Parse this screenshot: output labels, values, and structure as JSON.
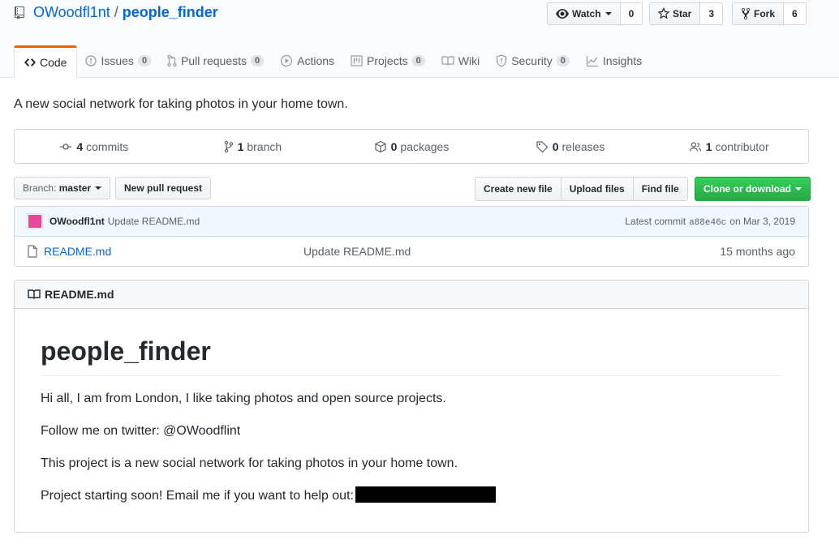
{
  "repo": {
    "owner": "OWoodfl1nt",
    "separator": "/",
    "name": "people_finder"
  },
  "actions": {
    "watch": {
      "label": "Watch",
      "count": "0"
    },
    "star": {
      "label": "Star",
      "count": "3"
    },
    "fork": {
      "label": "Fork",
      "count": "6"
    }
  },
  "tabs": [
    {
      "label": "Code",
      "icon": "code-icon",
      "selected": true
    },
    {
      "label": "Issues",
      "icon": "issue-icon",
      "badge": "0"
    },
    {
      "label": "Pull requests",
      "icon": "pull-request-icon",
      "badge": "0"
    },
    {
      "label": "Actions",
      "icon": "play-icon"
    },
    {
      "label": "Projects",
      "icon": "project-icon",
      "badge": "0"
    },
    {
      "label": "Wiki",
      "icon": "book-icon"
    },
    {
      "label": "Security",
      "icon": "shield-icon",
      "badge": "0"
    },
    {
      "label": "Insights",
      "icon": "graph-icon"
    }
  ],
  "description": "A new social network for taking photos in your home town.",
  "summary": {
    "commits": {
      "count": "4",
      "label": "commits"
    },
    "branches": {
      "count": "1",
      "label": "branch"
    },
    "packages": {
      "count": "0",
      "label": "packages"
    },
    "releases": {
      "count": "0",
      "label": "releases"
    },
    "contributors": {
      "count": "1",
      "label": "contributor"
    }
  },
  "toolbar": {
    "branch_prefix": "Branch:",
    "branch_name": "master",
    "new_pr": "New pull request",
    "create_file": "Create new file",
    "upload_files": "Upload files",
    "find_file": "Find file",
    "clone": "Clone or download"
  },
  "latest_commit": {
    "author": "OWoodfl1nt",
    "message": "Update README.md",
    "prefix": "Latest commit",
    "sha": "a88e46c",
    "date": "on Mar 3, 2019"
  },
  "files": [
    {
      "name": "README.md",
      "message": "Update README.md",
      "age": "15 months ago"
    }
  ],
  "readme": {
    "filename": "README.md",
    "title": "people_finder",
    "paragraphs": [
      "Hi all, I am from London, I like taking photos and open source projects.",
      "Follow me on twitter: @OWoodflint",
      "This project is a new social network for taking photos in your home town.",
      "Project starting soon! Email me if you want to help out:"
    ]
  },
  "colors": {
    "accent_tab": "#e36209",
    "link": "#0366d6",
    "clone_button": "#28a745",
    "avatar": "#e8489a"
  }
}
